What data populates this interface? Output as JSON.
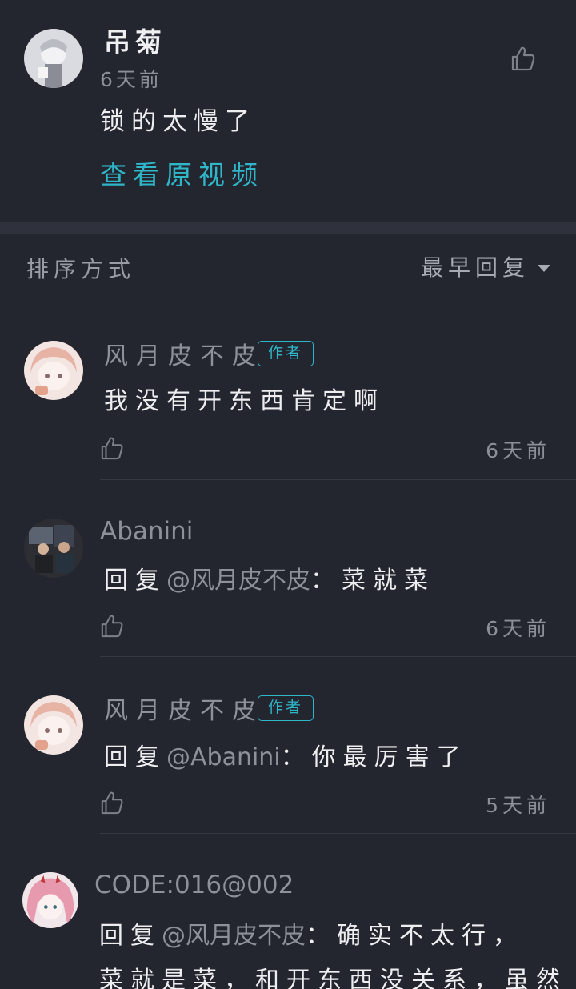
{
  "root_comment": {
    "author": "吊菊",
    "time": "6天前",
    "text": "锁的太慢了",
    "view_video_link": "查看原视频"
  },
  "sort_bar": {
    "label": "排序方式",
    "value": "最早回复"
  },
  "replies": [
    {
      "author": "风月皮不皮",
      "badge": "作者",
      "prefix": "",
      "mention": "",
      "text": "我没有开东西肯定啊",
      "time": "6天前"
    },
    {
      "author": "Abanini",
      "badge": "",
      "prefix": "回复",
      "mention": "@风月皮不皮",
      "text": "：菜就菜",
      "time": "6天前"
    },
    {
      "author": "风月皮不皮",
      "badge": "作者",
      "prefix": "回复",
      "mention": "@Abanini",
      "text": "：你最厉害了",
      "time": "5天前"
    },
    {
      "author": "CODE:016@002",
      "badge": "",
      "prefix": "回复",
      "mention": "@风月皮不皮",
      "text": "：确实不太行，",
      "text_line2": "菜就是菜，和开东西没关系，虽然"
    }
  ],
  "icons": {
    "like": "thumbs-up-icon",
    "sort_caret": "caret-down-icon"
  },
  "colors": {
    "background": "#23252f",
    "accent": "#2fb7c9"
  }
}
